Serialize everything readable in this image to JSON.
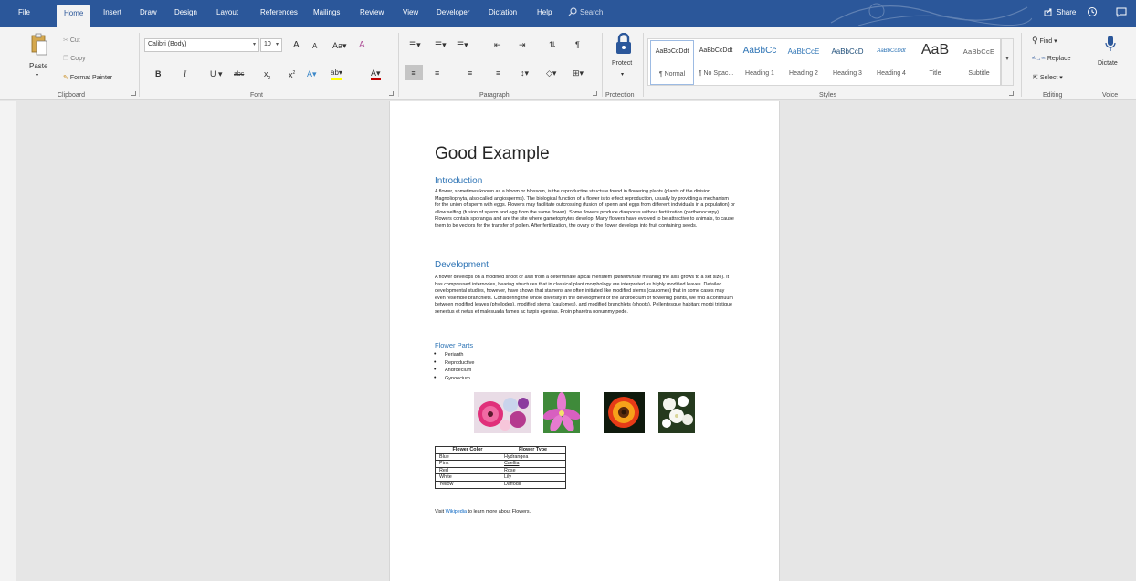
{
  "tabs": [
    "File",
    "Home",
    "Insert",
    "Draw",
    "Design",
    "Layout",
    "References",
    "Mailings",
    "Review",
    "View",
    "Developer",
    "Dictation",
    "Help"
  ],
  "search_label": "Search",
  "share_label": "Share",
  "clipboard": {
    "paste": "Paste",
    "cut": "Cut",
    "copy": "Copy",
    "format_painter": "Format Painter",
    "group": "Clipboard"
  },
  "font": {
    "name": "Calibri (Body)",
    "size": "10",
    "group": "Font"
  },
  "paragraph": {
    "group": "Paragraph"
  },
  "protection": {
    "protect": "Protect",
    "group": "Protection"
  },
  "styles": {
    "group": "Styles",
    "items": [
      {
        "sample": "AaBbCcDdt",
        "name": "¶ Normal"
      },
      {
        "sample": "AaBbCcDdt",
        "name": "¶ No Spac..."
      },
      {
        "sample": "AaBbCc",
        "name": "Heading 1"
      },
      {
        "sample": "AaBbCcE",
        "name": "Heading 2"
      },
      {
        "sample": "AaBbCcD",
        "name": "Heading 3"
      },
      {
        "sample": "AaBbCcDdt",
        "name": "Heading 4"
      },
      {
        "sample": "AaB",
        "name": "Title"
      },
      {
        "sample": "AaBbCcE",
        "name": "Subtitle"
      }
    ]
  },
  "editing": {
    "find": "Find",
    "replace": "Replace",
    "select": "Select",
    "group": "Editing"
  },
  "voice": {
    "dictate": "Dictate",
    "group": "Voice"
  },
  "document": {
    "title": "Good Example",
    "intro_heading": "Introduction",
    "intro_text": "A flower, sometimes known as a bloom or blossom, is the reproductive structure found in flowering plants (plants of the division Magnoliophyta, also called angiosperms). The biological function of a flower is to effect reproduction, usually by providing a mechanism for the union of sperm with eggs. Flowers may facilitate outcrossing (fusion of sperm and eggs from different individuals in a population) or allow selfing (fusion of sperm and egg from the same flower). Some flowers produce diaspores without fertilization (parthenocarpy). Flowers contain sporangia and are the site where gametophytes develop. Many flowers have evolved to be attractive to animals, to cause them to be vectors for the transfer of pollen. After fertilization, the ovary of the flower develops into fruit containing seeds.",
    "dev_heading": "Development",
    "dev_text_1": "A flower develops on a modified shoot or ",
    "dev_text_axis": "axis",
    "dev_text_2": " from a determinate apical meristem (",
    "dev_text_determinate": "determinate",
    "dev_text_3": " meaning the axis grows to a set size). It has compressed internodes, bearing structures that in classical plant morphology are interpreted as highly modified leaves. Detailed developmental studies, however, have shown that stamens are often initiated like modified stems (caulomes) that in some cases may even resemble branchlets. Considering the whole diversity in the development of the androecium of flowering plants, we find a continuum between modified leaves (phyllodes), modified stems (caulomes), and modified branchlets (shoots). Pellentesque habitant morbi tristique senectus et netus et malesuada fames ac turpis egestas. Proin pharetra nonummy pede.",
    "parts_heading": "Flower Parts",
    "parts": [
      "Perianth",
      "Reproductive",
      "Androecium",
      "Gynoecium"
    ],
    "table_headers": [
      "Flower Color",
      "Flower Type"
    ],
    "table_rows": [
      [
        "Blue",
        "Hydrangea"
      ],
      [
        "Pink",
        "Caellia"
      ],
      [
        "Red",
        "Rose"
      ],
      [
        "White",
        "Lily"
      ],
      [
        "Yellow",
        "Daffodil"
      ]
    ],
    "visit_before": "Visit ",
    "visit_link": "Wikipedia",
    "visit_after": " to learn more about Flowers."
  },
  "colors": {
    "accent": "#2b579a",
    "heading": "#2e74b5",
    "link": "#0563c1"
  }
}
